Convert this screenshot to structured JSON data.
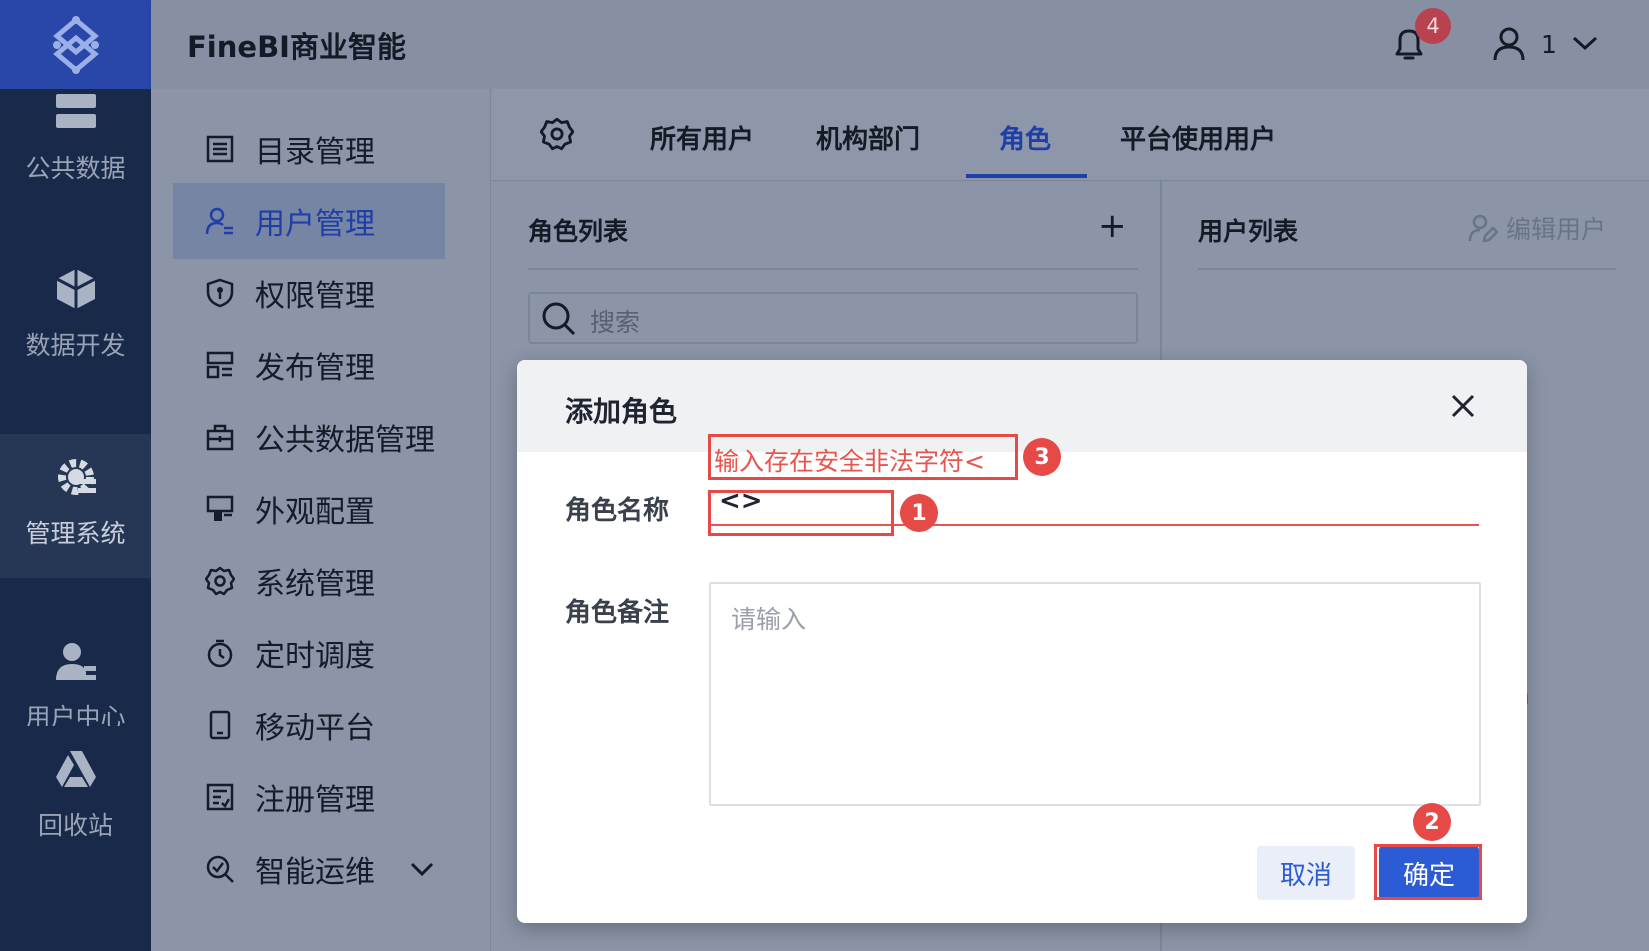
{
  "header": {
    "app_title": "FineBI商业智能",
    "notification_count": "4",
    "user_name": "1"
  },
  "rail": {
    "items": [
      {
        "label": "公共数据",
        "icon": "database-icon"
      },
      {
        "label": "数据开发",
        "icon": "cube-icon"
      },
      {
        "label": "管理系统",
        "icon": "gear-icon",
        "active": true
      },
      {
        "label": "用户中心",
        "icon": "user-center-icon"
      },
      {
        "label": "回收站",
        "icon": "recycle-icon"
      }
    ]
  },
  "sidebar": {
    "items": [
      {
        "label": "目录管理",
        "icon": "list-icon"
      },
      {
        "label": "用户管理",
        "icon": "user-manage-icon",
        "active": true
      },
      {
        "label": "权限管理",
        "icon": "shield-icon"
      },
      {
        "label": "发布管理",
        "icon": "publish-icon"
      },
      {
        "label": "公共数据管理",
        "icon": "briefcase-icon"
      },
      {
        "label": "外观配置",
        "icon": "appearance-icon"
      },
      {
        "label": "系统管理",
        "icon": "gear-icon"
      },
      {
        "label": "定时调度",
        "icon": "timer-icon"
      },
      {
        "label": "移动平台",
        "icon": "mobile-icon"
      },
      {
        "label": "注册管理",
        "icon": "register-icon"
      },
      {
        "label": "智能运维",
        "icon": "ops-icon"
      }
    ]
  },
  "tabs": {
    "items": [
      {
        "label": "所有用户"
      },
      {
        "label": "机构部门"
      },
      {
        "label": "角色",
        "active": true
      },
      {
        "label": "平台使用用户"
      }
    ]
  },
  "roles_panel": {
    "title": "角色列表",
    "add_label": "+",
    "search_placeholder": "搜索"
  },
  "users_panel": {
    "title": "用户列表",
    "edit_label": "编辑用户"
  },
  "modal": {
    "title": "添加角色",
    "name_label": "角色名称",
    "name_value": "<>",
    "error_text": "输入存在安全非法字符<",
    "remark_label": "角色备注",
    "remark_placeholder": "请输入",
    "cancel_label": "取消",
    "ok_label": "确定"
  },
  "annotations": {
    "one": "1",
    "two": "2",
    "three": "3"
  },
  "colors": {
    "accent": "#2c5bd6",
    "error": "#e54a47",
    "rail": "#18294a"
  }
}
